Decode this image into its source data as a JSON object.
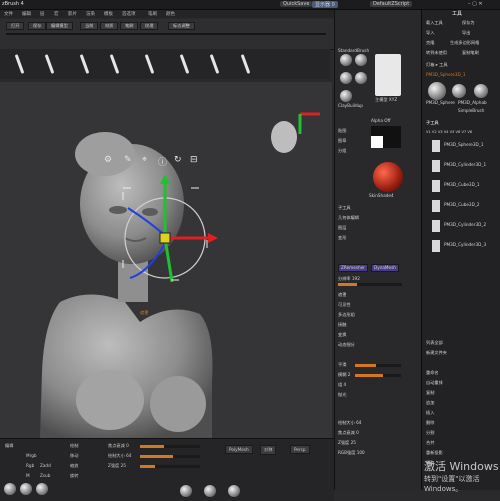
{
  "title_bar": {
    "app_title": "zBrush 4",
    "quicksave": "QuickSave",
    "status_pill": "显示器 0",
    "default_script": "DefaultZScript",
    "window_buttons": "– ▢ ✕"
  },
  "menu": {
    "items": [
      "文件",
      "编辑",
      "层",
      "宏",
      "影片",
      "渲染",
      "模板",
      "首选项",
      "笔刷",
      "颜色",
      "工具"
    ]
  },
  "top_strip": {
    "labels": [
      "打开",
      "保存",
      "编辑模型",
      "当前",
      "材质",
      "笔刷",
      "纹理",
      "标志调整"
    ]
  },
  "viewport": {
    "toolbar_icons": [
      "gear-icon",
      "pin-icon",
      "location-icon",
      "info-icon",
      "refresh-icon",
      "lock-icon"
    ],
    "mask_label": "遮罩"
  },
  "right_panel": {
    "thumb_labels": [
      "StandardBrush",
      "DamStandard",
      "Move",
      "Inflate",
      "ClayBuildup",
      "Smooth"
    ],
    "head_label": "主模型 XYZ",
    "alpha_label": "Alpha Off",
    "texture_label": "Texture Off",
    "material_label": "SkinShade4",
    "items": [
      "贴图",
      "图章",
      "分组",
      "子工具",
      "几何体编辑",
      "图层",
      "变形",
      "遮罩",
      "可见性",
      "多边形组",
      "接触",
      "变换",
      "动态细分"
    ],
    "dynamesh_label": "DynaMesh",
    "zremesher_label": "ZRemesher",
    "resolution": "分辨率 192",
    "smooth": "平滑",
    "blur": "模糊 2",
    "groups": "组 4",
    "polish": "抛光",
    "draw_size_label": "绘制大小 64",
    "focal_label": "焦点衰减 0",
    "intensity_label": "Z强度 25",
    "rgb_label": "RGB强度 100"
  },
  "tool_panel": {
    "header": "工具",
    "buttons": [
      "载入工具",
      "保存为",
      "导入",
      "导出",
      "克隆",
      "生成多边形网格",
      "转到未使用",
      "复制笔刷"
    ],
    "lightbox": "灯箱 ▸ 工具",
    "current_tool": "PM3D_Sphere3D_1",
    "thumbs": [
      "PM3D_Sphere",
      "PM3D_Alphab",
      "SimpleBrush"
    ],
    "subtool_header": "子工具",
    "subtool_tabs": [
      "V1",
      "V2",
      "V3",
      "V4",
      "V5",
      "V6",
      "V7",
      "V8"
    ],
    "subtools": [
      "PM3D_Sphere3D_1",
      "PM3D_Cylinder3D_1",
      "PM3D_Cube3D_1",
      "PM3D_Cube3D_2",
      "PM3D_Cylinder3D_2",
      "PM3D_Cylinder3D_3"
    ],
    "footer_items": [
      "列表全部",
      "新建文件夹",
      "重命名",
      "自动重排",
      "复制",
      "追加",
      "插入",
      "删除",
      "分割",
      "合并",
      "重新投影",
      "提取"
    ]
  },
  "bottom_bar": {
    "labels": [
      "绘制",
      "移动",
      "缩放",
      "旋转",
      "编辑",
      "Mrgb",
      "Rgb",
      "M",
      "Zadd",
      "Zsub"
    ],
    "field_1": "焦点衰减 0",
    "field_2": "绘制大小 64",
    "field_3": "Z强度 25",
    "persp": "PolyMesh",
    "button_a": "对称",
    "button_b": "Persp"
  },
  "watermark": {
    "line1": "激活 Windows",
    "line2": "转到\"设置\"以激活 Windows。"
  },
  "colors": {
    "accent": "#d5771d",
    "panel": "#29292b",
    "viewport": "#353537",
    "gizmo_red": "#e02020",
    "gizmo_green": "#20c030",
    "gizmo_blue": "#2040e0"
  }
}
